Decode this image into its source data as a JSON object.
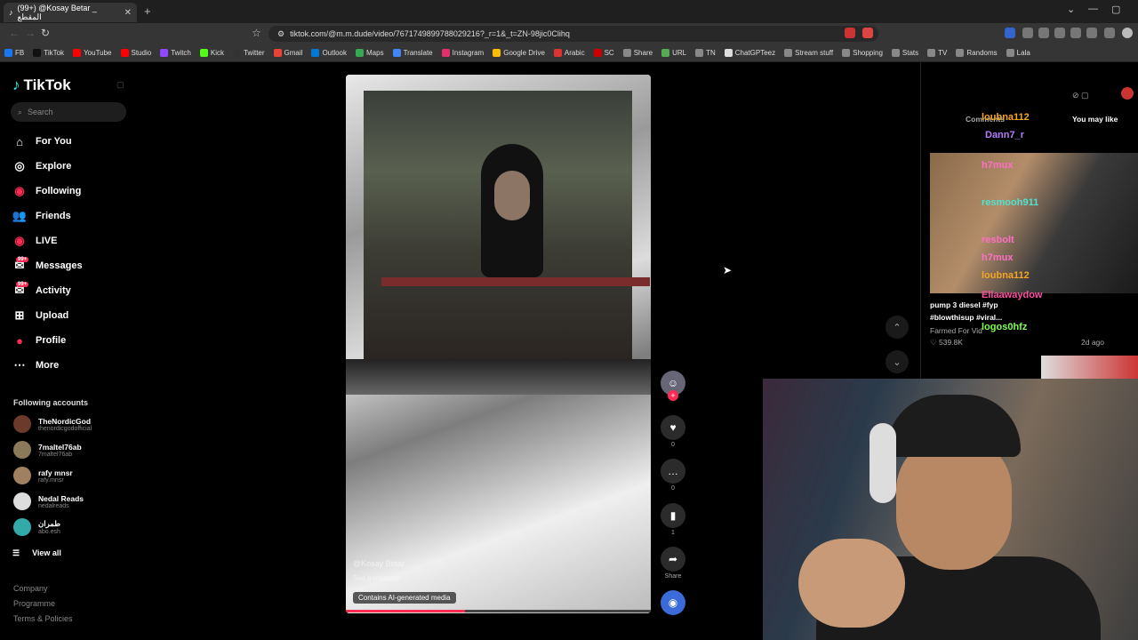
{
  "browser": {
    "tab_title": "(99+) @Kosay Betar _ المقطع",
    "url": "tiktok.com/@m.m.dude/video/7671749899788029216?_r=1&_t=ZN-98jic0Clihq",
    "bookmarks": [
      {
        "label": "FB",
        "color": "#1877f2"
      },
      {
        "label": "TikTok",
        "color": "#111"
      },
      {
        "label": "YouTube",
        "color": "#ff0000"
      },
      {
        "label": "Studio",
        "color": "#ff0000"
      },
      {
        "label": "Twitch",
        "color": "#9146ff"
      },
      {
        "label": "Kick",
        "color": "#53fc18"
      },
      {
        "label": "Twitter",
        "color": "#333"
      },
      {
        "label": "Gmail",
        "color": "#ea4335"
      },
      {
        "label": "Outlook",
        "color": "#0078d4"
      },
      {
        "label": "Maps",
        "color": "#34a853"
      },
      {
        "label": "Translate",
        "color": "#4285f4"
      },
      {
        "label": "Instagram",
        "color": "#e1306c"
      },
      {
        "label": "Google Drive",
        "color": "#fbbc04"
      },
      {
        "label": "Arabic",
        "color": "#d33"
      },
      {
        "label": "SC",
        "color": "#c00"
      },
      {
        "label": "Share",
        "color": "#888"
      },
      {
        "label": "URL",
        "color": "#5a5"
      },
      {
        "label": "TN",
        "color": "#888"
      },
      {
        "label": "ChatGPTeez",
        "color": "#ddd"
      },
      {
        "label": "Stream stuff",
        "color": "#888"
      },
      {
        "label": "Shopping",
        "color": "#888"
      },
      {
        "label": "Stats",
        "color": "#888"
      },
      {
        "label": "TV",
        "color": "#888"
      },
      {
        "label": "Randoms",
        "color": "#888"
      },
      {
        "label": "Lala",
        "color": "#888"
      }
    ]
  },
  "sidebar": {
    "logo": "TikTok",
    "search_placeholder": "Search",
    "nav": [
      {
        "label": "For You",
        "icon": "home-icon"
      },
      {
        "label": "Explore",
        "icon": "compass-icon"
      },
      {
        "label": "Following",
        "icon": "following-icon"
      },
      {
        "label": "Friends",
        "icon": "friends-icon"
      },
      {
        "label": "LIVE",
        "icon": "live-icon"
      },
      {
        "label": "Messages",
        "icon": "messages-icon",
        "badge": "99+"
      },
      {
        "label": "Activity",
        "icon": "activity-icon",
        "badge": "99+"
      },
      {
        "label": "Upload",
        "icon": "upload-icon"
      },
      {
        "label": "Profile",
        "icon": "profile-icon"
      },
      {
        "label": "More",
        "icon": "more-icon"
      }
    ],
    "following_title": "Following accounts",
    "accounts": [
      {
        "name": "TheNordicGod",
        "handle": "thenordicgodofficial",
        "color": "#6b3a2a"
      },
      {
        "name": "7maltel76ab",
        "handle": "7maltel76ab",
        "color": "#8a7a5a"
      },
      {
        "name": "rafy mnsr",
        "handle": "rafy.mnsr",
        "color": "#a08060"
      },
      {
        "name": "Nedal Reads",
        "handle": "nedalreads",
        "color": "#ddd"
      },
      {
        "name": "طمران",
        "handle": "abo.esh",
        "color": "#3aa"
      }
    ],
    "view_all": "View all",
    "footer": [
      "Company",
      "Programme",
      "Terms & Policies"
    ]
  },
  "video": {
    "caption_user": "@Kosay Betar",
    "see_translation": "See translation",
    "ai_tag": "Contains AI-generated media",
    "progress": 0.39
  },
  "actions": {
    "likes": "0",
    "comments": "0",
    "saves": "1",
    "share_label": "Share"
  },
  "right_panel": {
    "comments_label": "Comments",
    "you_may_like": "You may like",
    "video_title": "pump 3 diesel #fyp",
    "hashtags": "#blowthisup #viral...",
    "farmed": "Farmed For Vid",
    "views": "539.8K",
    "age": "2d ago"
  },
  "chat": [
    {
      "user": "loubna112",
      "color": "#f5a623"
    },
    {
      "user": "Dann7_r",
      "color": "#b57bff"
    },
    {
      "user": "h7mux",
      "color": "#ff6ec7"
    },
    {
      "user": "resmooh911",
      "color": "#4de3d0"
    },
    {
      "user": "resbolt",
      "color": "#ff6ec7"
    },
    {
      "user": "h7mux",
      "color": "#ff6ec7"
    },
    {
      "user": "loubna112",
      "color": "#f5a623"
    },
    {
      "user": "Ellaawaydow",
      "color": "#ff4fa3"
    },
    {
      "user": "logos0hfz",
      "color": "#7cff4d"
    }
  ]
}
